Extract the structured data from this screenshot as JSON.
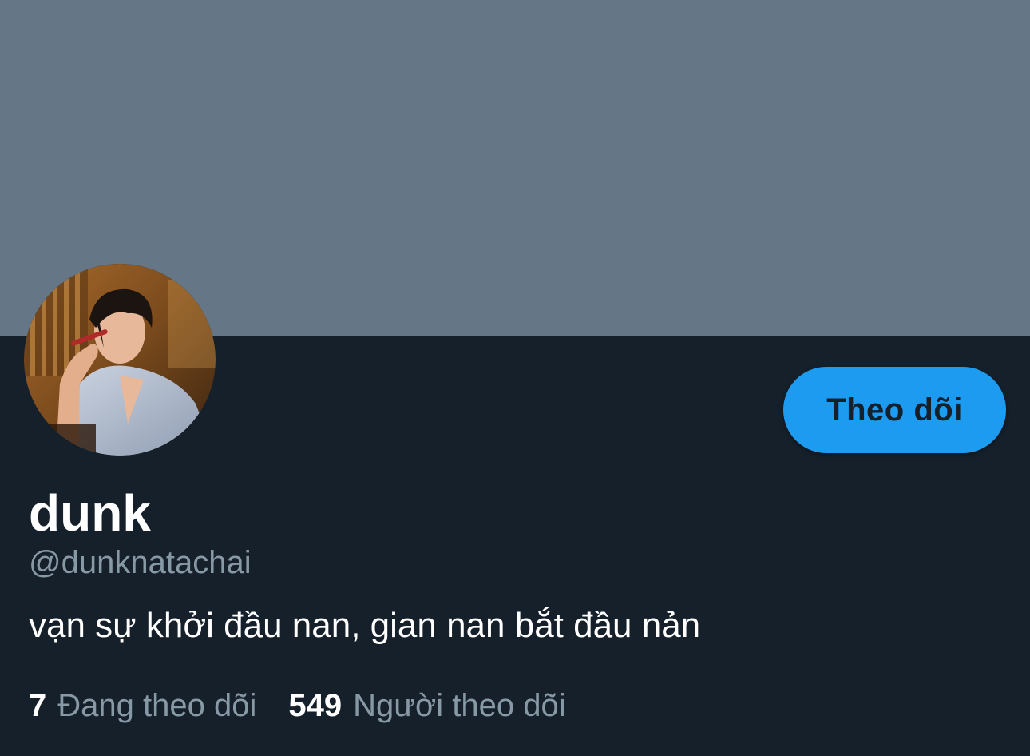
{
  "banner": {
    "color": "#657786"
  },
  "profile": {
    "display_name": "dunk",
    "handle": "@dunknatachai",
    "bio": "vạn sự khởi đầu nan, gian nan bắt đầu nản",
    "follow_button_label": "Theo dõi"
  },
  "stats": {
    "following_count": "7",
    "following_label": "Đang theo dõi",
    "followers_count": "549",
    "followers_label": "Người theo dõi"
  },
  "colors": {
    "background": "#15202b",
    "accent": "#1d9bf0",
    "secondary_text": "#8899a6",
    "primary_text": "#ffffff"
  },
  "icons": {
    "avatar": "profile-photo"
  }
}
